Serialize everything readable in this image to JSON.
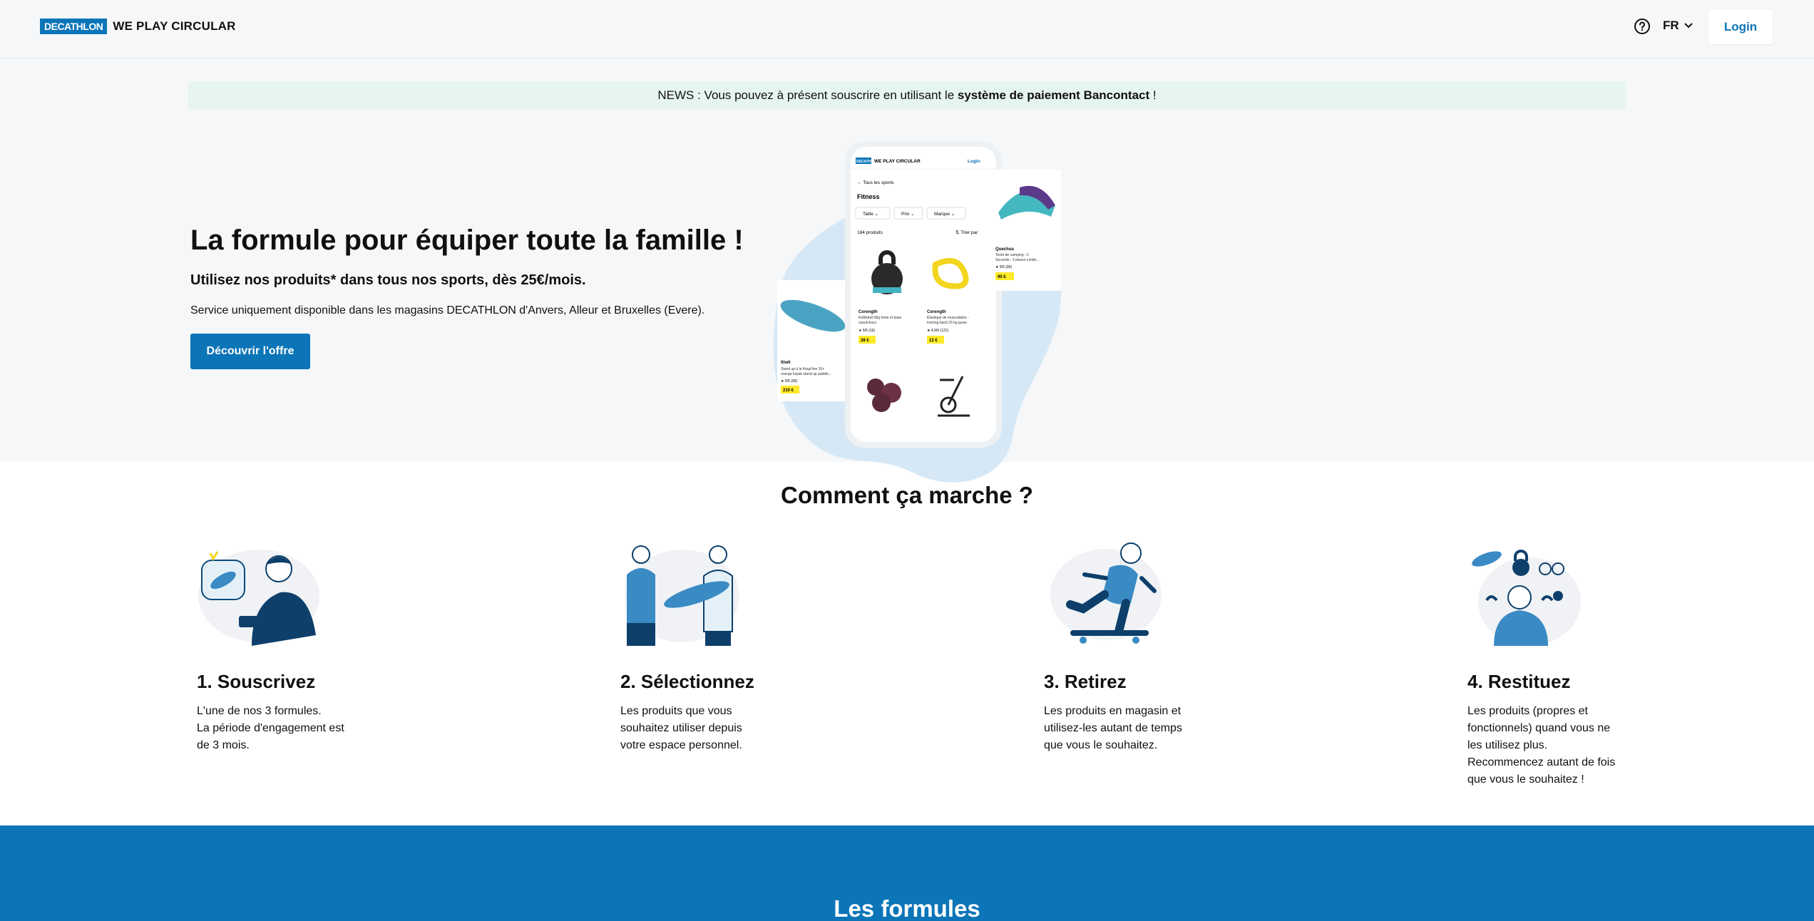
{
  "header": {
    "logo_brand": "DECATHLON",
    "logo_tagline": "WE PLAY CIRCULAR",
    "help_icon": "question-circle-icon",
    "language": "FR",
    "login_label": "Login"
  },
  "news": {
    "prefix": "NEWS : Vous pouvez à présent souscrire en utilisant le ",
    "bold": "système de paiement Bancontact",
    "suffix": " !"
  },
  "hero": {
    "title": "La formule pour équiper toute la famille !",
    "subtitle": "Utilisez nos produits* dans tous nos sports, dès 25€/mois.",
    "description": "Service uniquement disponible dans les magasins DECATHLON d'Anvers, Alleur et Bruxelles (Evere).",
    "cta_label": "Découvrir l'offre"
  },
  "phone_mockup": {
    "brand": "DECATHLON",
    "tagline": "WE PLAY CIRCULAR",
    "login": "Login",
    "back": "← Tous les sports",
    "category": "Fitness",
    "filters": [
      "Taille ⌄",
      "Prix ⌄",
      "Marque ⌄"
    ],
    "count": "184 produits",
    "sort": "⇅ Trier par",
    "products": [
      {
        "brand": "Corength",
        "name": "Kettlebell 8kg fonte et base caoutchouc",
        "rating": "★ 5/5 (16)",
        "price": "28 €"
      },
      {
        "brand": "Corength",
        "name": "Élastique de musculation - training band 25 kg jaune",
        "rating": "★ 4.9/5 (121)",
        "price": "12 €"
      }
    ],
    "side_left": {
      "brand": "Itiwit",
      "name": "Stand up à la fiziqu'line 10+ - orange kayak stand up paddle...",
      "rating": "★ 5/5 (99)",
      "price": "210 €"
    },
    "side_right": {
      "brand": "Quechua",
      "name": "Tente de camping - 2 Seconds - 3 places Limité...",
      "rating": "★ 5/5 (99)",
      "price": "90 €"
    }
  },
  "how": {
    "title": "Comment ça marche ?",
    "steps": [
      {
        "title": "1. Souscrivez",
        "lines": [
          "L'une de nos 3 formules.",
          "La période d'engagement est",
          "de 3 mois."
        ],
        "icon": "subscribe-illustration-icon"
      },
      {
        "title": "2. Sélectionnez",
        "lines": [
          "Les produits que vous",
          "souhaitez utiliser depuis",
          "votre espace personnel."
        ],
        "icon": "select-illustration-icon"
      },
      {
        "title": "3. Retirez",
        "lines": [
          "Les produits en magasin et",
          "utilisez-les autant de temps",
          "que vous le souhaitez."
        ],
        "icon": "pickup-illustration-icon"
      },
      {
        "title": "4. Restituez",
        "lines": [
          "Les produits (propres et",
          "fonctionnels) quand vous ne",
          "les utilisez plus.",
          "Recommencez autant de fois",
          "que vous le souhaitez !"
        ],
        "icon": "return-illustration-icon"
      }
    ]
  },
  "formules": {
    "title": "Les formules"
  },
  "colors": {
    "brand_blue": "#0b75b8",
    "news_bg": "#e7f5f0",
    "hero_bg": "#f5f7f9",
    "price_yellow": "#ffea28"
  }
}
